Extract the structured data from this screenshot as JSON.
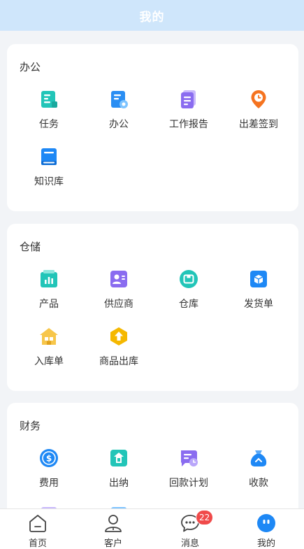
{
  "header": {
    "title": "我的"
  },
  "sections": {
    "office": {
      "title": "办公",
      "items": [
        {
          "label": "任务",
          "icon": "task-icon"
        },
        {
          "label": "办公",
          "icon": "office-icon"
        },
        {
          "label": "工作报告",
          "icon": "report-icon"
        },
        {
          "label": "出差签到",
          "icon": "location-icon"
        },
        {
          "label": "知识库",
          "icon": "book-icon"
        }
      ]
    },
    "storage": {
      "title": "仓储",
      "items": [
        {
          "label": "产品",
          "icon": "product-icon"
        },
        {
          "label": "供应商",
          "icon": "supplier-icon"
        },
        {
          "label": "仓库",
          "icon": "warehouse-icon"
        },
        {
          "label": "发货单",
          "icon": "shipment-icon"
        },
        {
          "label": "入库单",
          "icon": "inbound-icon"
        },
        {
          "label": "商品出库",
          "icon": "outbound-icon"
        }
      ]
    },
    "finance": {
      "title": "财务",
      "items": [
        {
          "label": "费用",
          "icon": "expense-icon"
        },
        {
          "label": "出纳",
          "icon": "cashier-icon"
        },
        {
          "label": "回款计划",
          "icon": "payment-plan-icon"
        },
        {
          "label": "收款",
          "icon": "money-bag-icon"
        }
      ]
    }
  },
  "tabbar": {
    "items": [
      {
        "label": "首页",
        "icon": "home-icon"
      },
      {
        "label": "客户",
        "icon": "customer-icon"
      },
      {
        "label": "消息",
        "icon": "message-icon",
        "badge": "22"
      },
      {
        "label": "我的",
        "icon": "profile-icon"
      }
    ]
  },
  "colors": {
    "header_bg": "#cfe6fb",
    "accent_blue": "#1e88f5",
    "badge_red": "#f04a4a",
    "teal": "#26c6b8",
    "purple": "#8a6cf0",
    "orange": "#f5731f",
    "amber": "#f5b800"
  }
}
